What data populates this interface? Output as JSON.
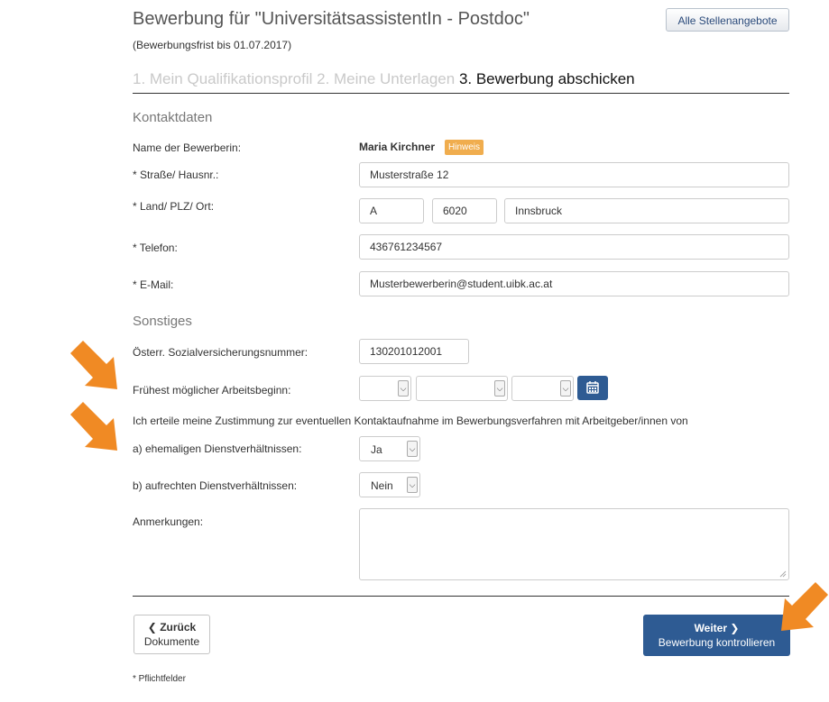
{
  "header": {
    "title": "Bewerbung für \"UniversitätsassistentIn - Postdoc\"",
    "deadline": "(Bewerbungsfrist bis 01.07.2017)",
    "all_jobs_button": "Alle Stellenangebote"
  },
  "steps": [
    {
      "label": "1. Mein Qualifikationsprofil",
      "state": "done"
    },
    {
      "label": "2. Meine Unterlagen",
      "state": "done"
    },
    {
      "label": "3. Bewerbung abschicken",
      "state": "active"
    }
  ],
  "contact": {
    "section_title": "Kontaktdaten",
    "name_label": "Name der Bewerberin:",
    "name_value": "Maria Kirchner",
    "hint_badge": "Hinweis",
    "street_label": "* Straße/ Hausnr.:",
    "street_value": "Musterstraße 12",
    "location_label": "* Land/ PLZ/ Ort:",
    "country_value": "A",
    "zip_value": "6020",
    "city_value": "Innsbruck",
    "phone_label": "* Telefon:",
    "phone_value": "436761234567",
    "email_label": "* E-Mail:",
    "email_value": "Musterbewerberin@student.uibk.ac.at"
  },
  "other": {
    "section_title": "Sonstiges",
    "ssn_label": "Österr. Sozialversicherungsnummer:",
    "ssn_value": "130201012001",
    "start_label": "Frühest möglicher Arbeitsbeginn:",
    "start_day": "",
    "start_month": "",
    "start_year": "",
    "consent_text": "Ich erteile meine Zustimmung zur eventuellen Kontaktaufnahme im Bewerbungsverfahren mit Arbeitgeber/innen von",
    "former_label": "a) ehemaligen Dienstverhältnissen:",
    "former_value": "Ja",
    "current_label": "b) aufrechten Dienstverhältnissen:",
    "current_value": "Nein",
    "remarks_label": "Anmerkungen:",
    "remarks_value": ""
  },
  "footer": {
    "back_title": "Zurück",
    "back_sub": "Dokumente",
    "next_title": "Weiter",
    "next_sub": "Bewerbung kontrollieren",
    "required_note": "* Pflichtfelder"
  },
  "colors": {
    "primary": "#2e5b93",
    "hint": "#f0ad4e",
    "arrow": "#f08a24"
  },
  "icons": [
    "calendar-icon",
    "chevron-left-icon",
    "chevron-right-icon",
    "chevron-down-icon",
    "annotation-arrow"
  ]
}
